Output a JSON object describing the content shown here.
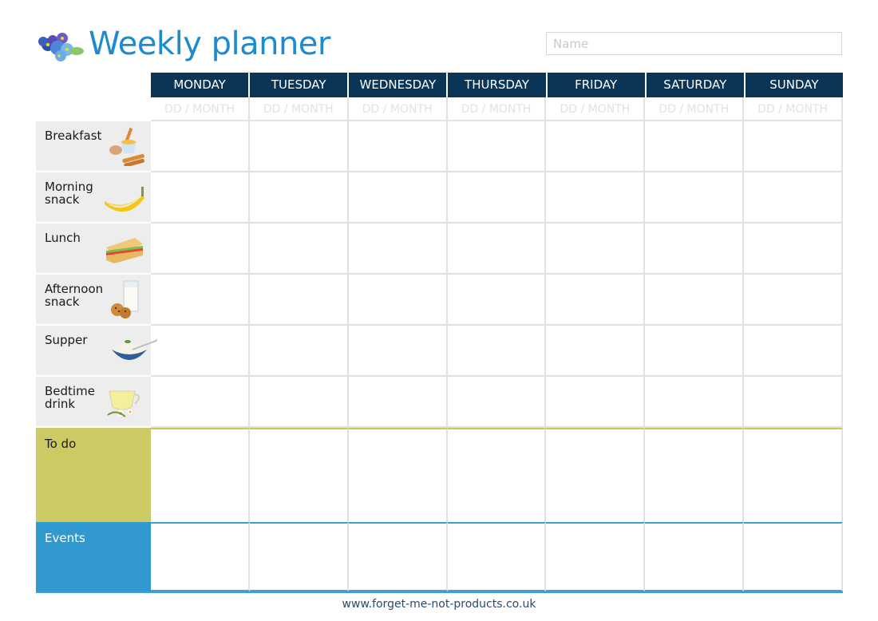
{
  "header": {
    "title": "Weekly planner",
    "logo_icon": "forget-me-not-flower-icon",
    "name_field": {
      "placeholder": "Name",
      "value": ""
    }
  },
  "days": [
    {
      "label": "MONDAY",
      "date_placeholder": "DD / MONTH"
    },
    {
      "label": "TUESDAY",
      "date_placeholder": "DD / MONTH"
    },
    {
      "label": "WEDNESDAY",
      "date_placeholder": "DD / MONTH"
    },
    {
      "label": "THURSDAY",
      "date_placeholder": "DD / MONTH"
    },
    {
      "label": "FRIDAY",
      "date_placeholder": "DD / MONTH"
    },
    {
      "label": "SATURDAY",
      "date_placeholder": "DD / MONTH"
    },
    {
      "label": "SUNDAY",
      "date_placeholder": "DD / MONTH"
    }
  ],
  "meals": [
    {
      "label": "Breakfast",
      "icon": "egg-and-toast-icon"
    },
    {
      "label": "Morning snack",
      "icon": "banana-icon"
    },
    {
      "label": "Lunch",
      "icon": "sandwich-icon"
    },
    {
      "label": "Afternoon snack",
      "icon": "milk-and-cookies-icon"
    },
    {
      "label": "Supper",
      "icon": "rice-bowl-icon"
    },
    {
      "label": "Bedtime drink",
      "icon": "herbal-tea-icon"
    }
  ],
  "sections": {
    "todo": {
      "label": "To do",
      "color": "#cccb63"
    },
    "events": {
      "label": "Events",
      "color": "#3199cf"
    }
  },
  "colors": {
    "title": "#1e8bcf",
    "day_header_bg": "#0b3556",
    "meal_label_bg": "#ededed"
  },
  "footer": {
    "url_text": "www.forget-me-not-products.co.uk"
  }
}
